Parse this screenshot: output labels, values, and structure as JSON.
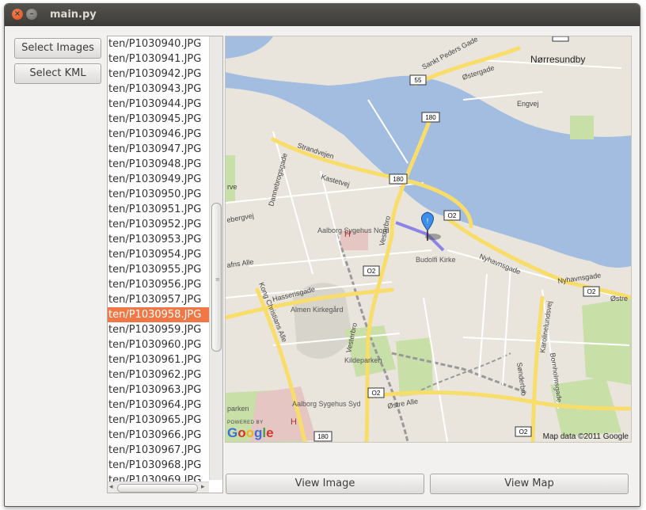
{
  "window": {
    "title": "main.py"
  },
  "buttons": {
    "select_images": "Select Images",
    "select_kml": "Select KML",
    "view_image": "View Image",
    "view_map": "View Map"
  },
  "file_list": {
    "selected_index": 18,
    "items": [
      "ten/P1030940.JPG",
      "ten/P1030941.JPG",
      "ten/P1030942.JPG",
      "ten/P1030943.JPG",
      "ten/P1030944.JPG",
      "ten/P1030945.JPG",
      "ten/P1030946.JPG",
      "ten/P1030947.JPG",
      "ten/P1030948.JPG",
      "ten/P1030949.JPG",
      "ten/P1030950.JPG",
      "ten/P1030951.JPG",
      "ten/P1030952.JPG",
      "ten/P1030953.JPG",
      "ten/P1030954.JPG",
      "ten/P1030955.JPG",
      "ten/P1030956.JPG",
      "ten/P1030957.JPG",
      "ten/P1030958.JPG",
      "ten/P1030959.JPG",
      "ten/P1030960.JPG",
      "ten/P1030961.JPG",
      "ten/P1030962.JPG",
      "ten/P1030963.JPG",
      "ten/P1030964.JPG",
      "ten/P1030965.JPG",
      "ten/P1030966.JPG",
      "ten/P1030967.JPG",
      "ten/P1030968.JPG",
      "ten/P1030969.JPG"
    ]
  },
  "map": {
    "city": "Nørresundby",
    "attribution": "Map data ©2011 Google",
    "powered_by": "POWERED BY",
    "logo_text": "Google",
    "road_shields": [
      "55",
      "180",
      "180",
      "O2",
      "O2",
      "O2",
      "O2",
      "O2",
      "180",
      "O2"
    ],
    "street_labels": {
      "sankt_peders": "Sankt Peders Gade",
      "ostergade": "Østergade",
      "engvej": "Engvej",
      "strandvejen": "Strandvejen",
      "kastetvej": "Kastetvej",
      "dannebrogsgade": "Dannebrogsgade",
      "vesterbro": "Vesterbro",
      "nyhavnsgade": "Nyhavnsgade",
      "hasserisgade": "Hasserisgade",
      "kong_christians": "Kong Christians Alle",
      "vestre_bro2": "Vesterbro",
      "ostre_alle": "Østre Alle",
      "sonderbro": "Sønderbro",
      "karolinelund": "Karolinelundsvej",
      "bornholmsgade": "Bornholmsgade",
      "nyhavnsgade2": "Nyhavnsgade",
      "ostre": "Østre",
      "kastet_alle": "afns Alle",
      "ebergvej": "ebergvej",
      "rve": "rve"
    },
    "places": {
      "hospital_nord": "Aalborg Sygehus Nord",
      "budolfi": "Budolfi Kirke",
      "almen": "Almen Kirkegård",
      "kildeparken": "Kildeparken",
      "hospital_syd": "Aalborg Sygehus Syd",
      "parken": "parken"
    },
    "colors": {
      "water": "#a3bde0",
      "land": "#e9e5dc",
      "park": "#c8dfa8",
      "major_road": "#f9dd6a",
      "marker": "#3d8ee8",
      "track": "#7c72e8"
    }
  }
}
